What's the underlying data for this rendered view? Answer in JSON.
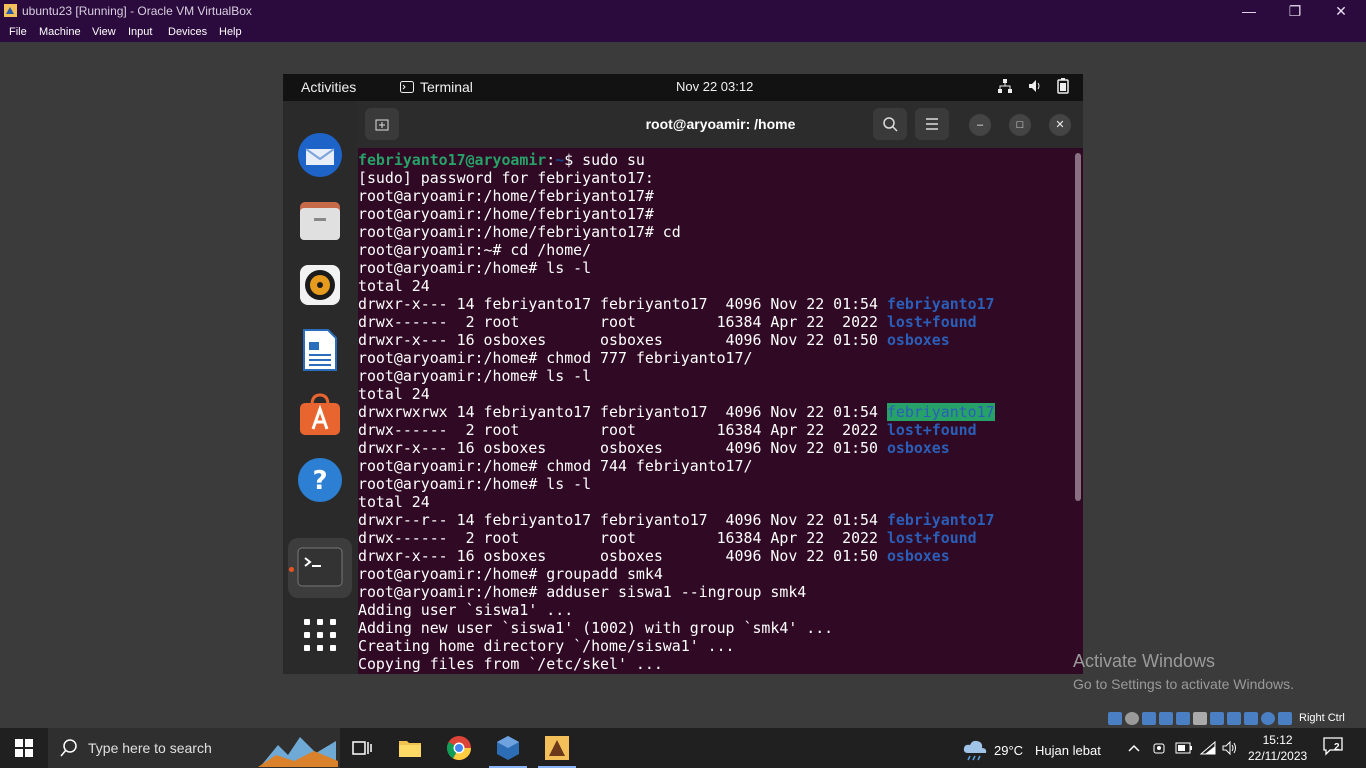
{
  "vbox": {
    "title": "ubuntu23 [Running] - Oracle VM VirtualBox",
    "menu": [
      "File",
      "Machine",
      "View",
      "Input",
      "Devices",
      "Help"
    ],
    "status_label": "Right Ctrl"
  },
  "gnome": {
    "activities": "Activities",
    "app_name": "Terminal",
    "clock": "Nov 22  03:12"
  },
  "terminal": {
    "title": "root@aryoamir: /home",
    "lines": [
      [
        {
          "t": "febriyanto17@aryoamir",
          "c": "pu"
        },
        {
          "t": ":",
          "c": ""
        },
        {
          "t": "~",
          "c": "pp"
        },
        {
          "t": "$ sudo su",
          "c": ""
        }
      ],
      [
        {
          "t": "[sudo] password for febriyanto17:",
          "c": ""
        }
      ],
      [
        {
          "t": "root@aryoamir:/home/febriyanto17#",
          "c": ""
        }
      ],
      [
        {
          "t": "root@aryoamir:/home/febriyanto17#",
          "c": ""
        }
      ],
      [
        {
          "t": "root@aryoamir:/home/febriyanto17# cd",
          "c": ""
        }
      ],
      [
        {
          "t": "root@aryoamir:~# cd /home/",
          "c": ""
        }
      ],
      [
        {
          "t": "root@aryoamir:/home# ls -l",
          "c": ""
        }
      ],
      [
        {
          "t": "total 24",
          "c": ""
        }
      ],
      [
        {
          "t": "drwxr-x--- 14 febriyanto17 febriyanto17  4096 Nov 22 01:54 ",
          "c": ""
        },
        {
          "t": "febriyanto17",
          "c": "dir"
        }
      ],
      [
        {
          "t": "drwx------  2 root         root         16384 Apr 22  2022 ",
          "c": ""
        },
        {
          "t": "lost+found",
          "c": "dir"
        }
      ],
      [
        {
          "t": "drwxr-x--- 16 osboxes      osboxes       4096 Nov 22 01:50 ",
          "c": ""
        },
        {
          "t": "osboxes",
          "c": "dir"
        }
      ],
      [
        {
          "t": "root@aryoamir:/home# chmod 777 febriyanto17/",
          "c": ""
        }
      ],
      [
        {
          "t": "root@aryoamir:/home# ls -l",
          "c": ""
        }
      ],
      [
        {
          "t": "total 24",
          "c": ""
        }
      ],
      [
        {
          "t": "drwxrwxrwx 14 febriyanto17 febriyanto17  4096 Nov 22 01:54 ",
          "c": ""
        },
        {
          "t": "febriyanto17",
          "c": "dir-hl"
        }
      ],
      [
        {
          "t": "drwx------  2 root         root         16384 Apr 22  2022 ",
          "c": ""
        },
        {
          "t": "lost+found",
          "c": "dir"
        }
      ],
      [
        {
          "t": "drwxr-x--- 16 osboxes      osboxes       4096 Nov 22 01:50 ",
          "c": ""
        },
        {
          "t": "osboxes",
          "c": "dir"
        }
      ],
      [
        {
          "t": "root@aryoamir:/home# chmod 744 febriyanto17/",
          "c": ""
        }
      ],
      [
        {
          "t": "root@aryoamir:/home# ls -l",
          "c": ""
        }
      ],
      [
        {
          "t": "total 24",
          "c": ""
        }
      ],
      [
        {
          "t": "drwxr--r-- 14 febriyanto17 febriyanto17  4096 Nov 22 01:54 ",
          "c": ""
        },
        {
          "t": "febriyanto17",
          "c": "dir"
        }
      ],
      [
        {
          "t": "drwx------  2 root         root         16384 Apr 22  2022 ",
          "c": ""
        },
        {
          "t": "lost+found",
          "c": "dir"
        }
      ],
      [
        {
          "t": "drwxr-x--- 16 osboxes      osboxes       4096 Nov 22 01:50 ",
          "c": ""
        },
        {
          "t": "osboxes",
          "c": "dir"
        }
      ],
      [
        {
          "t": "root@aryoamir:/home# groupadd smk4",
          "c": ""
        }
      ],
      [
        {
          "t": "root@aryoamir:/home# adduser siswa1 --ingroup smk4",
          "c": ""
        }
      ],
      [
        {
          "t": "Adding user `siswa1' ...",
          "c": ""
        }
      ],
      [
        {
          "t": "Adding new user `siswa1' (1002) with group `smk4' ...",
          "c": ""
        }
      ],
      [
        {
          "t": "Creating home directory `/home/siswa1' ...",
          "c": ""
        }
      ],
      [
        {
          "t": "Copying files from `/etc/skel' ...",
          "c": ""
        }
      ]
    ]
  },
  "dock": {
    "items": [
      "thunderbird-icon",
      "files-icon",
      "rhythmbox-icon",
      "writer-icon",
      "software-icon",
      "help-icon",
      "terminal-icon",
      "show-apps-icon"
    ]
  },
  "watermark": {
    "line1": "Activate Windows",
    "line2": "Go to Settings to activate Windows."
  },
  "taskbar": {
    "search_placeholder": "Type here to search",
    "weather_temp": "29°C",
    "weather_desc": "Hujan lebat",
    "time": "15:12",
    "date": "22/11/2023",
    "notification_count": "2"
  }
}
